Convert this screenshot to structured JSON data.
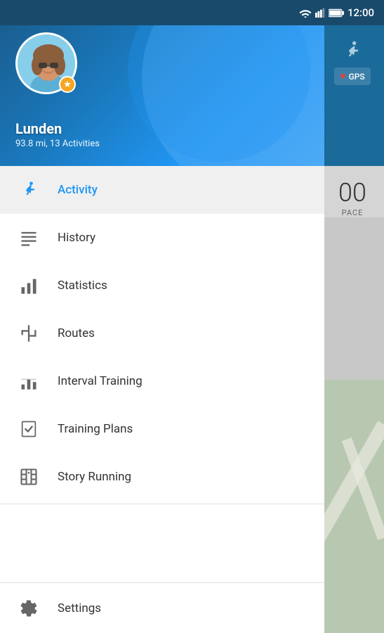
{
  "statusBar": {
    "time": "12:00"
  },
  "rightPanel": {
    "gpsLabel": "GPS",
    "paceNumber": "00",
    "paceLabel": "PACE"
  },
  "header": {
    "userName": "Lunden",
    "userStats": "93.8 mi, 13 Activities"
  },
  "menu": {
    "items": [
      {
        "id": "activity",
        "label": "Activity",
        "active": true
      },
      {
        "id": "history",
        "label": "History",
        "active": false
      },
      {
        "id": "statistics",
        "label": "Statistics",
        "active": false
      },
      {
        "id": "routes",
        "label": "Routes",
        "active": false
      },
      {
        "id": "interval-training",
        "label": "Interval Training",
        "active": false
      },
      {
        "id": "training-plans",
        "label": "Training Plans",
        "active": false
      },
      {
        "id": "story-running",
        "label": "Story Running",
        "active": false
      }
    ],
    "settings": {
      "label": "Settings"
    }
  }
}
